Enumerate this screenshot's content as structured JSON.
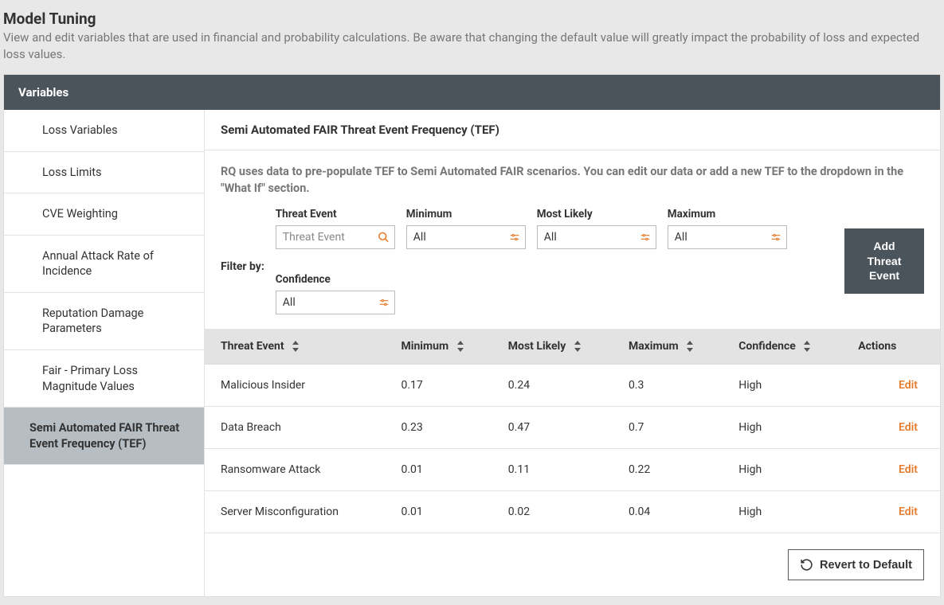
{
  "page": {
    "title": "Model Tuning",
    "subtitle": "View and edit variables that are used in financial and probability calculations. Be aware that changing the default value will greatly impact the probability of loss and expected loss values."
  },
  "panel": {
    "header": "Variables"
  },
  "sidebar": {
    "items": [
      {
        "label": "Loss Variables",
        "active": false
      },
      {
        "label": "Loss Limits",
        "active": false
      },
      {
        "label": "CVE Weighting",
        "active": false
      },
      {
        "label": "Annual Attack Rate of Incidence",
        "active": false
      },
      {
        "label": "Reputation Damage Parameters",
        "active": false
      },
      {
        "label": "Fair - Primary Loss Magnitude Values",
        "active": false
      },
      {
        "label": "Semi Automated FAIR Threat Event Frequency (TEF)",
        "active": true
      }
    ]
  },
  "content": {
    "title": "Semi Automated FAIR Threat Event Frequency (TEF)",
    "description": "RQ uses data to pre-populate TEF to Semi Automated FAIR scenarios. You can edit our data or add a new TEF to the dropdown in the \"What If\" section.",
    "filter_by_label": "Filter by:",
    "filters": {
      "threat_event": {
        "label": "Threat Event",
        "placeholder": "Threat Event"
      },
      "minimum": {
        "label": "Minimum",
        "value": "All"
      },
      "most_likely": {
        "label": "Most Likely",
        "value": "All"
      },
      "maximum": {
        "label": "Maximum",
        "value": "All"
      },
      "confidence": {
        "label": "Confidence",
        "value": "All"
      }
    },
    "add_button": "Add Threat Event",
    "columns": {
      "threat_event": "Threat Event",
      "minimum": "Minimum",
      "most_likely": "Most Likely",
      "maximum": "Maximum",
      "confidence": "Confidence",
      "actions": "Actions"
    },
    "edit_label": "Edit",
    "rows": [
      {
        "threat_event": "Malicious Insider",
        "minimum": "0.17",
        "most_likely": "0.24",
        "maximum": "0.3",
        "confidence": "High"
      },
      {
        "threat_event": "Data Breach",
        "minimum": "0.23",
        "most_likely": "0.47",
        "maximum": "0.7",
        "confidence": "High"
      },
      {
        "threat_event": "Ransomware Attack",
        "minimum": "0.01",
        "most_likely": "0.11",
        "maximum": "0.22",
        "confidence": "High"
      },
      {
        "threat_event": "Server Misconfiguration",
        "minimum": "0.01",
        "most_likely": "0.02",
        "maximum": "0.04",
        "confidence": "High"
      }
    ],
    "revert_label": "Revert to Default"
  }
}
